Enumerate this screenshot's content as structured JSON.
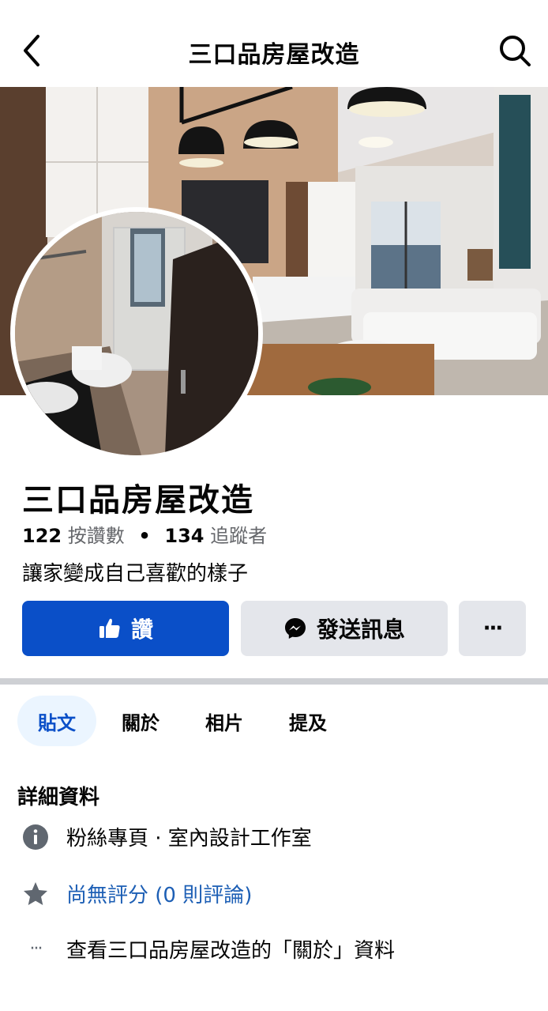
{
  "header": {
    "title": "三口品房屋改造"
  },
  "profile": {
    "name": "三口品房屋改造",
    "likes_count": "122",
    "likes_label": "按讚數",
    "separator": "•",
    "followers_count": "134",
    "followers_label": "追蹤者",
    "tagline": "讓家變成自己喜歡的樣子"
  },
  "actions": {
    "like_label": "讚",
    "message_label": "發送訊息",
    "more_label": "···"
  },
  "tabs": [
    {
      "label": "貼文",
      "active": true
    },
    {
      "label": "關於",
      "active": false
    },
    {
      "label": "相片",
      "active": false
    },
    {
      "label": "提及",
      "active": false
    }
  ],
  "details": {
    "title": "詳細資料",
    "category": "粉絲專頁 · 室內設計工作室",
    "rating": "尚無評分 (0 則評論)",
    "about_link": "查看三口品房屋改造的「關於」資料",
    "more_icon": "···"
  },
  "colors": {
    "primary": "#0a4fc8",
    "secondary_bg": "#e4e6eb",
    "link": "#1d5fb5",
    "muted": "#65676b"
  }
}
